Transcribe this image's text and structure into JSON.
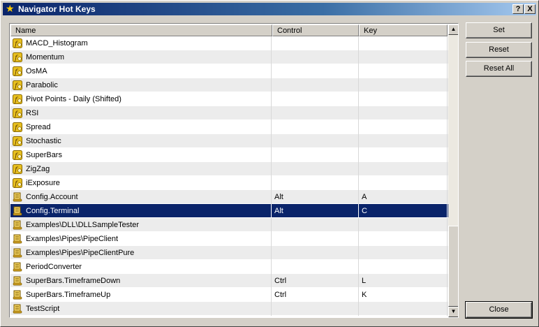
{
  "window": {
    "title": "Navigator Hot Keys",
    "help_label": "?",
    "close_label": "X"
  },
  "columns": {
    "name": "Name",
    "control": "Control",
    "key": "Key"
  },
  "rows": [
    {
      "name": "MACD_Histogram",
      "control": "",
      "key": "",
      "icon": "indicator-icon"
    },
    {
      "name": "Momentum",
      "control": "",
      "key": "",
      "icon": "indicator-icon"
    },
    {
      "name": "OsMA",
      "control": "",
      "key": "",
      "icon": "indicator-icon"
    },
    {
      "name": "Parabolic",
      "control": "",
      "key": "",
      "icon": "indicator-icon"
    },
    {
      "name": "Pivot Points - Daily (Shifted)",
      "control": "",
      "key": "",
      "icon": "indicator-icon"
    },
    {
      "name": "RSI",
      "control": "",
      "key": "",
      "icon": "indicator-icon"
    },
    {
      "name": "Spread",
      "control": "",
      "key": "",
      "icon": "indicator-icon"
    },
    {
      "name": "Stochastic",
      "control": "",
      "key": "",
      "icon": "indicator-icon"
    },
    {
      "name": "SuperBars",
      "control": "",
      "key": "",
      "icon": "indicator-icon"
    },
    {
      "name": "ZigZag",
      "control": "",
      "key": "",
      "icon": "indicator-icon"
    },
    {
      "name": "iExposure",
      "control": "",
      "key": "",
      "icon": "indicator-icon"
    },
    {
      "name": "Config.Account",
      "control": "Alt",
      "key": "A",
      "icon": "script-icon"
    },
    {
      "name": "Config.Terminal",
      "control": "Alt",
      "key": "C",
      "icon": "script-icon",
      "selected": true
    },
    {
      "name": "Examples\\DLL\\DLLSampleTester",
      "control": "",
      "key": "",
      "icon": "script-icon"
    },
    {
      "name": "Examples\\Pipes\\PipeClient",
      "control": "",
      "key": "",
      "icon": "script-icon"
    },
    {
      "name": "Examples\\Pipes\\PipeClientPure",
      "control": "",
      "key": "",
      "icon": "script-icon"
    },
    {
      "name": "PeriodConverter",
      "control": "",
      "key": "",
      "icon": "script-icon"
    },
    {
      "name": "SuperBars.TimeframeDown",
      "control": "Ctrl",
      "key": "L",
      "icon": "script-icon"
    },
    {
      "name": "SuperBars.TimeframeUp",
      "control": "Ctrl",
      "key": "K",
      "icon": "script-icon"
    },
    {
      "name": "TestScript",
      "control": "",
      "key": "",
      "icon": "script-icon"
    }
  ],
  "buttons": {
    "set": "Set",
    "reset": "Reset",
    "reset_all": "Reset All",
    "close": "Close"
  },
  "colors": {
    "selection": "#0a246a",
    "indicator_icon": "#e8c020",
    "script_icon": "#f0d060"
  }
}
